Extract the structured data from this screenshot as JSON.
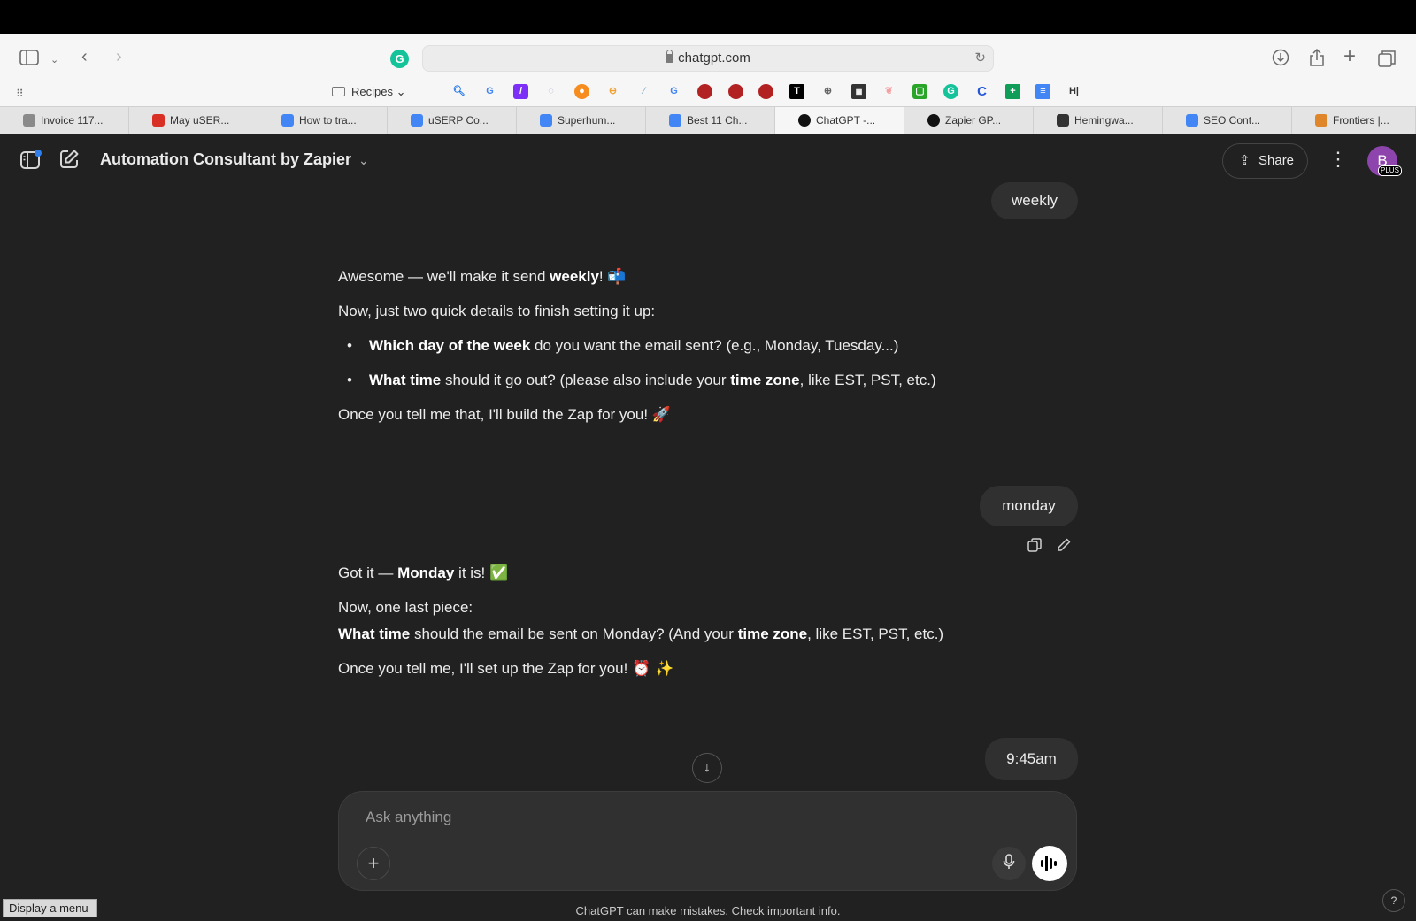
{
  "browser": {
    "url": "chatgpt.com",
    "bookmarks_folder": "Recipes",
    "tabs": [
      {
        "title": "Invoice 117...",
        "color": "#8a8a8a"
      },
      {
        "title": "May uSER...",
        "color": "#d93025"
      },
      {
        "title": "How to tra...",
        "color": "#4285f4"
      },
      {
        "title": "uSERP Co...",
        "color": "#4285f4"
      },
      {
        "title": "Superhum...",
        "color": "#4285f4"
      },
      {
        "title": "Best 11 Ch...",
        "color": "#4285f4"
      },
      {
        "title": "ChatGPT -...",
        "color": "#111111"
      },
      {
        "title": "Zapier GP...",
        "color": "#111111"
      },
      {
        "title": "Hemingwa...",
        "color": "#333333"
      },
      {
        "title": "SEO Cont...",
        "color": "#4285f4"
      },
      {
        "title": "Frontiers |...",
        "color": "#e0862a"
      }
    ]
  },
  "app": {
    "gpt_name": "Automation Consultant by Zapier",
    "share_label": "Share",
    "avatar_initial": "B",
    "avatar_badge": "PLUS"
  },
  "conversation": {
    "user_msg_1": "weekly",
    "assistant_1": {
      "line1_pre": "Awesome — we'll make it send ",
      "line1_bold": "weekly",
      "line1_post": "! 📬",
      "line2": "Now, just two quick details to finish setting it up:",
      "bullet1_bold": "Which day of the week",
      "bullet1_rest": " do you want the email sent? (e.g., Monday, Tuesday...)",
      "bullet2_bold1": "What time",
      "bullet2_mid": " should it go out? (please also include your ",
      "bullet2_bold2": "time zone",
      "bullet2_rest": ", like EST, PST, etc.)",
      "line3": "Once you tell me that, I'll build the Zap for you! 🚀"
    },
    "user_msg_2": "monday",
    "assistant_2": {
      "line1_pre": "Got it — ",
      "line1_bold": "Monday",
      "line1_post": " it is! ✅",
      "line2": "Now, one last piece:",
      "line3_bold1": "What time",
      "line3_mid": " should the email be sent on Monday? (And your ",
      "line3_bold2": "time zone",
      "line3_rest": ", like EST, PST, etc.)",
      "line4": "Once you tell me, I'll set up the Zap for you! ⏰ ✨"
    },
    "user_msg_3": "9:45am"
  },
  "composer": {
    "placeholder": "Ask anything"
  },
  "disclaimer": "ChatGPT can make mistakes. Check important info.",
  "tooltip": "Display a menu",
  "help_label": "?"
}
